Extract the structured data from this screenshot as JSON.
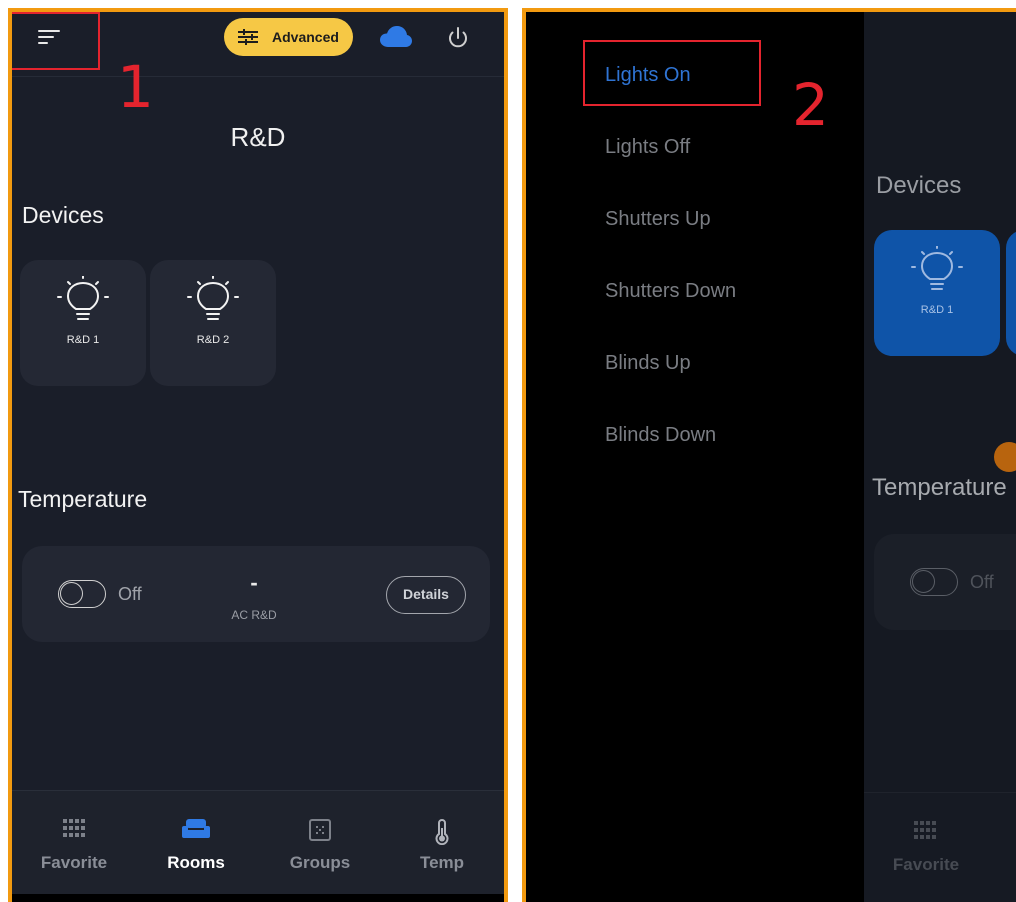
{
  "screen1": {
    "annotation_number": "1",
    "header": {
      "advanced_label": "Advanced"
    },
    "room_title": "R&D",
    "devices_heading": "Devices",
    "devices": [
      {
        "label": "R&D 1"
      },
      {
        "label": "R&D 2"
      }
    ],
    "temperature_heading": "Temperature",
    "temperature_card": {
      "toggle_state": "Off",
      "value": "-",
      "device_name": "AC R&D",
      "details_label": "Details"
    },
    "bottom_nav": [
      {
        "label": "Favorite",
        "icon": "grid-icon"
      },
      {
        "label": "Rooms",
        "icon": "sofa-icon",
        "active": true
      },
      {
        "label": "Groups",
        "icon": "groups-icon"
      },
      {
        "label": "Temp",
        "icon": "thermometer-icon"
      }
    ]
  },
  "screen2": {
    "annotation_number": "2",
    "drawer_items": [
      {
        "label": "Lights On",
        "active": true
      },
      {
        "label": "Lights Off"
      },
      {
        "label": "Shutters Up"
      },
      {
        "label": "Shutters Down"
      },
      {
        "label": "Blinds Up"
      },
      {
        "label": "Blinds Down"
      }
    ],
    "background": {
      "devices_heading": "Devices",
      "device_label": "R&D 1",
      "temperature_heading": "Temperature",
      "toggle_state": "Off",
      "nav_label": "Favorite"
    }
  },
  "colors": {
    "frame": "#f29a10",
    "annotation": "#e4242e",
    "accent_yellow": "#f6c845",
    "accent_blue": "#2f74d4",
    "background": "#1a1e29"
  }
}
